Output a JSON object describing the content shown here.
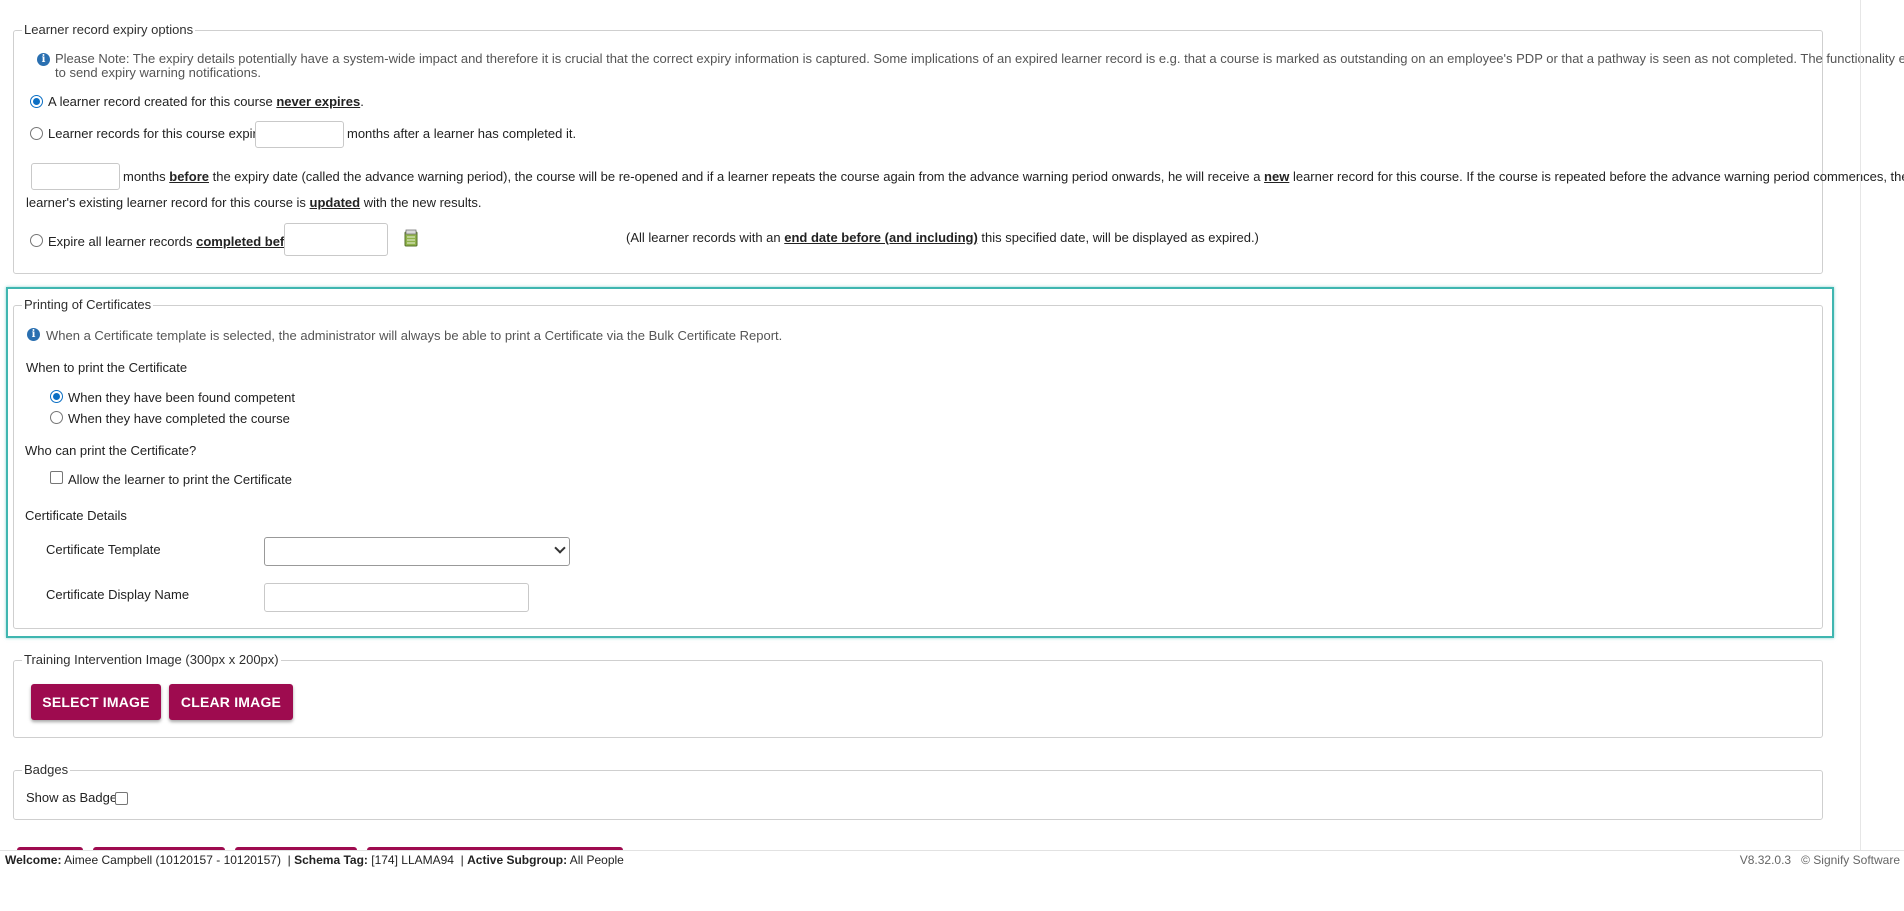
{
  "expiry": {
    "legend": "Learner record expiry options",
    "note": "Please Note: The expiry details potentially have a system-wide impact and therefore it is crucial that the correct expiry information is captured. Some implications of an expired learner record is e.g. that a course is marked as outstanding on an employee's PDP or that a pathway is seen as not completed. The functionality exists",
    "note_line2": "to send expiry warning notifications.",
    "opt_never_prefix": "A learner record created for this course ",
    "opt_never_emph": "never expires",
    "opt_never_suffix": ".",
    "opt_expire_prefix": "Learner records for this course expire",
    "opt_expire_suffix": "months after a learner has completed it.",
    "warn_1": "months ",
    "warn_before": "before",
    "warn_2": " the expiry date (called the advance warning period), the course will be re-opened and if a learner repeats the course again from the advance warning period onwards, he will receive a ",
    "warn_new": "new",
    "warn_3": " learner record for this course. If the course is repeated before the advance warning period commences, the",
    "warn_4": "learner's existing learner record for this course is ",
    "warn_updated": "updated",
    "warn_5": " with the new results.",
    "opt_completed_prefix": "Expire all learner records ",
    "opt_completed_emph": "completed before",
    "completed_hint_1": "(All learner records with an ",
    "completed_hint_emph": "end date before (and including)",
    "completed_hint_2": " this specified date, will be displayed as expired.)",
    "selected_option": "never-expires"
  },
  "certificates": {
    "legend": "Printing of Certificates",
    "note": "When a Certificate template is selected, the administrator will always be able to print a Certificate via the Bulk Certificate Report.",
    "when_label": "When to print the Certificate",
    "when_options": [
      "When they have been found competent",
      "When they have completed the course"
    ],
    "when_selected": 0,
    "who_label": "Who can print the Certificate?",
    "allow_learner_label": "Allow the learner to print the Certificate",
    "allow_learner_checked": false,
    "details_label": "Certificate Details",
    "template_label": "Certificate Template",
    "template_value": "",
    "display_name_label": "Certificate Display Name",
    "display_name_value": ""
  },
  "image": {
    "legend": "Training Intervention Image (300px x 200px)",
    "select_label": "SELECT IMAGE",
    "clear_label": "CLEAR IMAGE"
  },
  "badges": {
    "legend": "Badges",
    "show_label": "Show as Badge",
    "show_checked": false
  },
  "footer": {
    "welcome_label": "Welcome:",
    "welcome_value": " Aimee Campbell (10120157 - 10120157)",
    "schema_label": "Schema Tag:",
    "schema_value": " [174] LLAMA94",
    "subgroup_label": "Active Subgroup:",
    "subgroup_value": " All People",
    "version": "V8.32.0.3",
    "copyright": "© Signify Software"
  },
  "colors": {
    "accent": "#9e0b4f",
    "highlight": "#3fb6b0",
    "info": "#2a6fb0"
  }
}
